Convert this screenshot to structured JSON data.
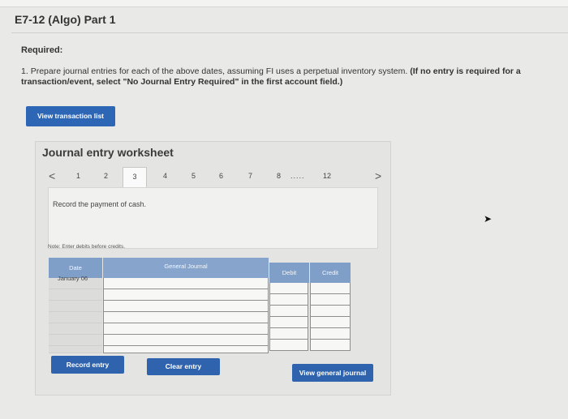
{
  "page": {
    "title": "E7-12 (Algo) Part 1",
    "required_label": "Required:",
    "instruction_number": "1.",
    "instruction_text": "Prepare journal entries for each of the above dates, assuming FI uses a perpetual inventory system.",
    "instruction_bold": "(If no entry is required for a transaction/event, select \"No Journal Entry Required\" in the first account field.)"
  },
  "buttons": {
    "view_transaction_list": "View transaction list",
    "record_entry": "Record entry",
    "clear_entry": "Clear entry",
    "view_general_journal": "View general journal"
  },
  "worksheet": {
    "title": "Journal entry worksheet",
    "pager": {
      "prev": "<",
      "next": ">",
      "pages": [
        "1",
        "2",
        "3",
        "4",
        "5",
        "6",
        "7",
        "8"
      ],
      "ellipsis": ".....",
      "last": "12",
      "active": "3"
    },
    "description": "Record the payment of cash.",
    "note": "Note: Enter debits before credits.",
    "table": {
      "headers": {
        "date": "Date",
        "account": "General Journal",
        "debit": "Debit",
        "credit": "Credit"
      },
      "date_value": "January 06"
    }
  },
  "colors": {
    "button": "#2f63ad",
    "header": "#7f9fc9"
  }
}
